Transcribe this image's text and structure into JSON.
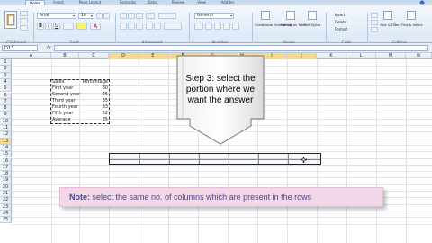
{
  "ribbon": {
    "tabs": [
      "Home",
      "Insert",
      "Page Layout",
      "Formulas",
      "Data",
      "Review",
      "View",
      "Add-Ins"
    ],
    "active_tab": "Home",
    "font_name": "Arial",
    "font_size": "10",
    "number_format": "General",
    "groups": [
      "Clipboard",
      "Font",
      "Alignment",
      "Number",
      "Styles",
      "Cells",
      "Editing"
    ],
    "styles_buttons": [
      "Conditional Formatting",
      "Format as Table",
      "Cell Styles"
    ],
    "cells_buttons": [
      "Insert",
      "Delete",
      "Format"
    ],
    "editing_buttons": [
      "Sort & Filter",
      "Find & Select"
    ]
  },
  "formula_bar": {
    "name_box": "D13",
    "fx": "fx",
    "formula": ""
  },
  "sheet": {
    "columns": [
      "A",
      "B",
      "C",
      "D",
      "E",
      "F",
      "G",
      "H",
      "I",
      "J",
      "K",
      "L",
      "M",
      "N"
    ],
    "rows": [
      "1",
      "2",
      "3",
      "4",
      "5",
      "6",
      "7",
      "8",
      "9",
      "10",
      "11",
      "12",
      "13",
      "14",
      "15",
      "16",
      "17",
      "18",
      "19",
      "20",
      "21",
      "22",
      "23",
      "24",
      "25"
    ],
    "table_header": [
      "Sales",
      "Percentage"
    ],
    "table_rows": [
      [
        "First year",
        "30"
      ],
      [
        "Second year",
        "25"
      ],
      [
        "Third year",
        "35"
      ],
      [
        "Fourth year",
        "33"
      ],
      [
        "Fifth year",
        "52"
      ],
      [
        "Average",
        "35"
      ]
    ]
  },
  "callout": {
    "text": "Step 3: select the portion where we want the answer"
  },
  "note": {
    "label": "Note:",
    "text": " select the same no. of columns which are present in the rows"
  },
  "colors": {
    "ribbon": "#dde8f6",
    "selected_header": "#f6d98c",
    "note_bg": "#f1d7e7",
    "note_text": "#3f4a9a"
  }
}
